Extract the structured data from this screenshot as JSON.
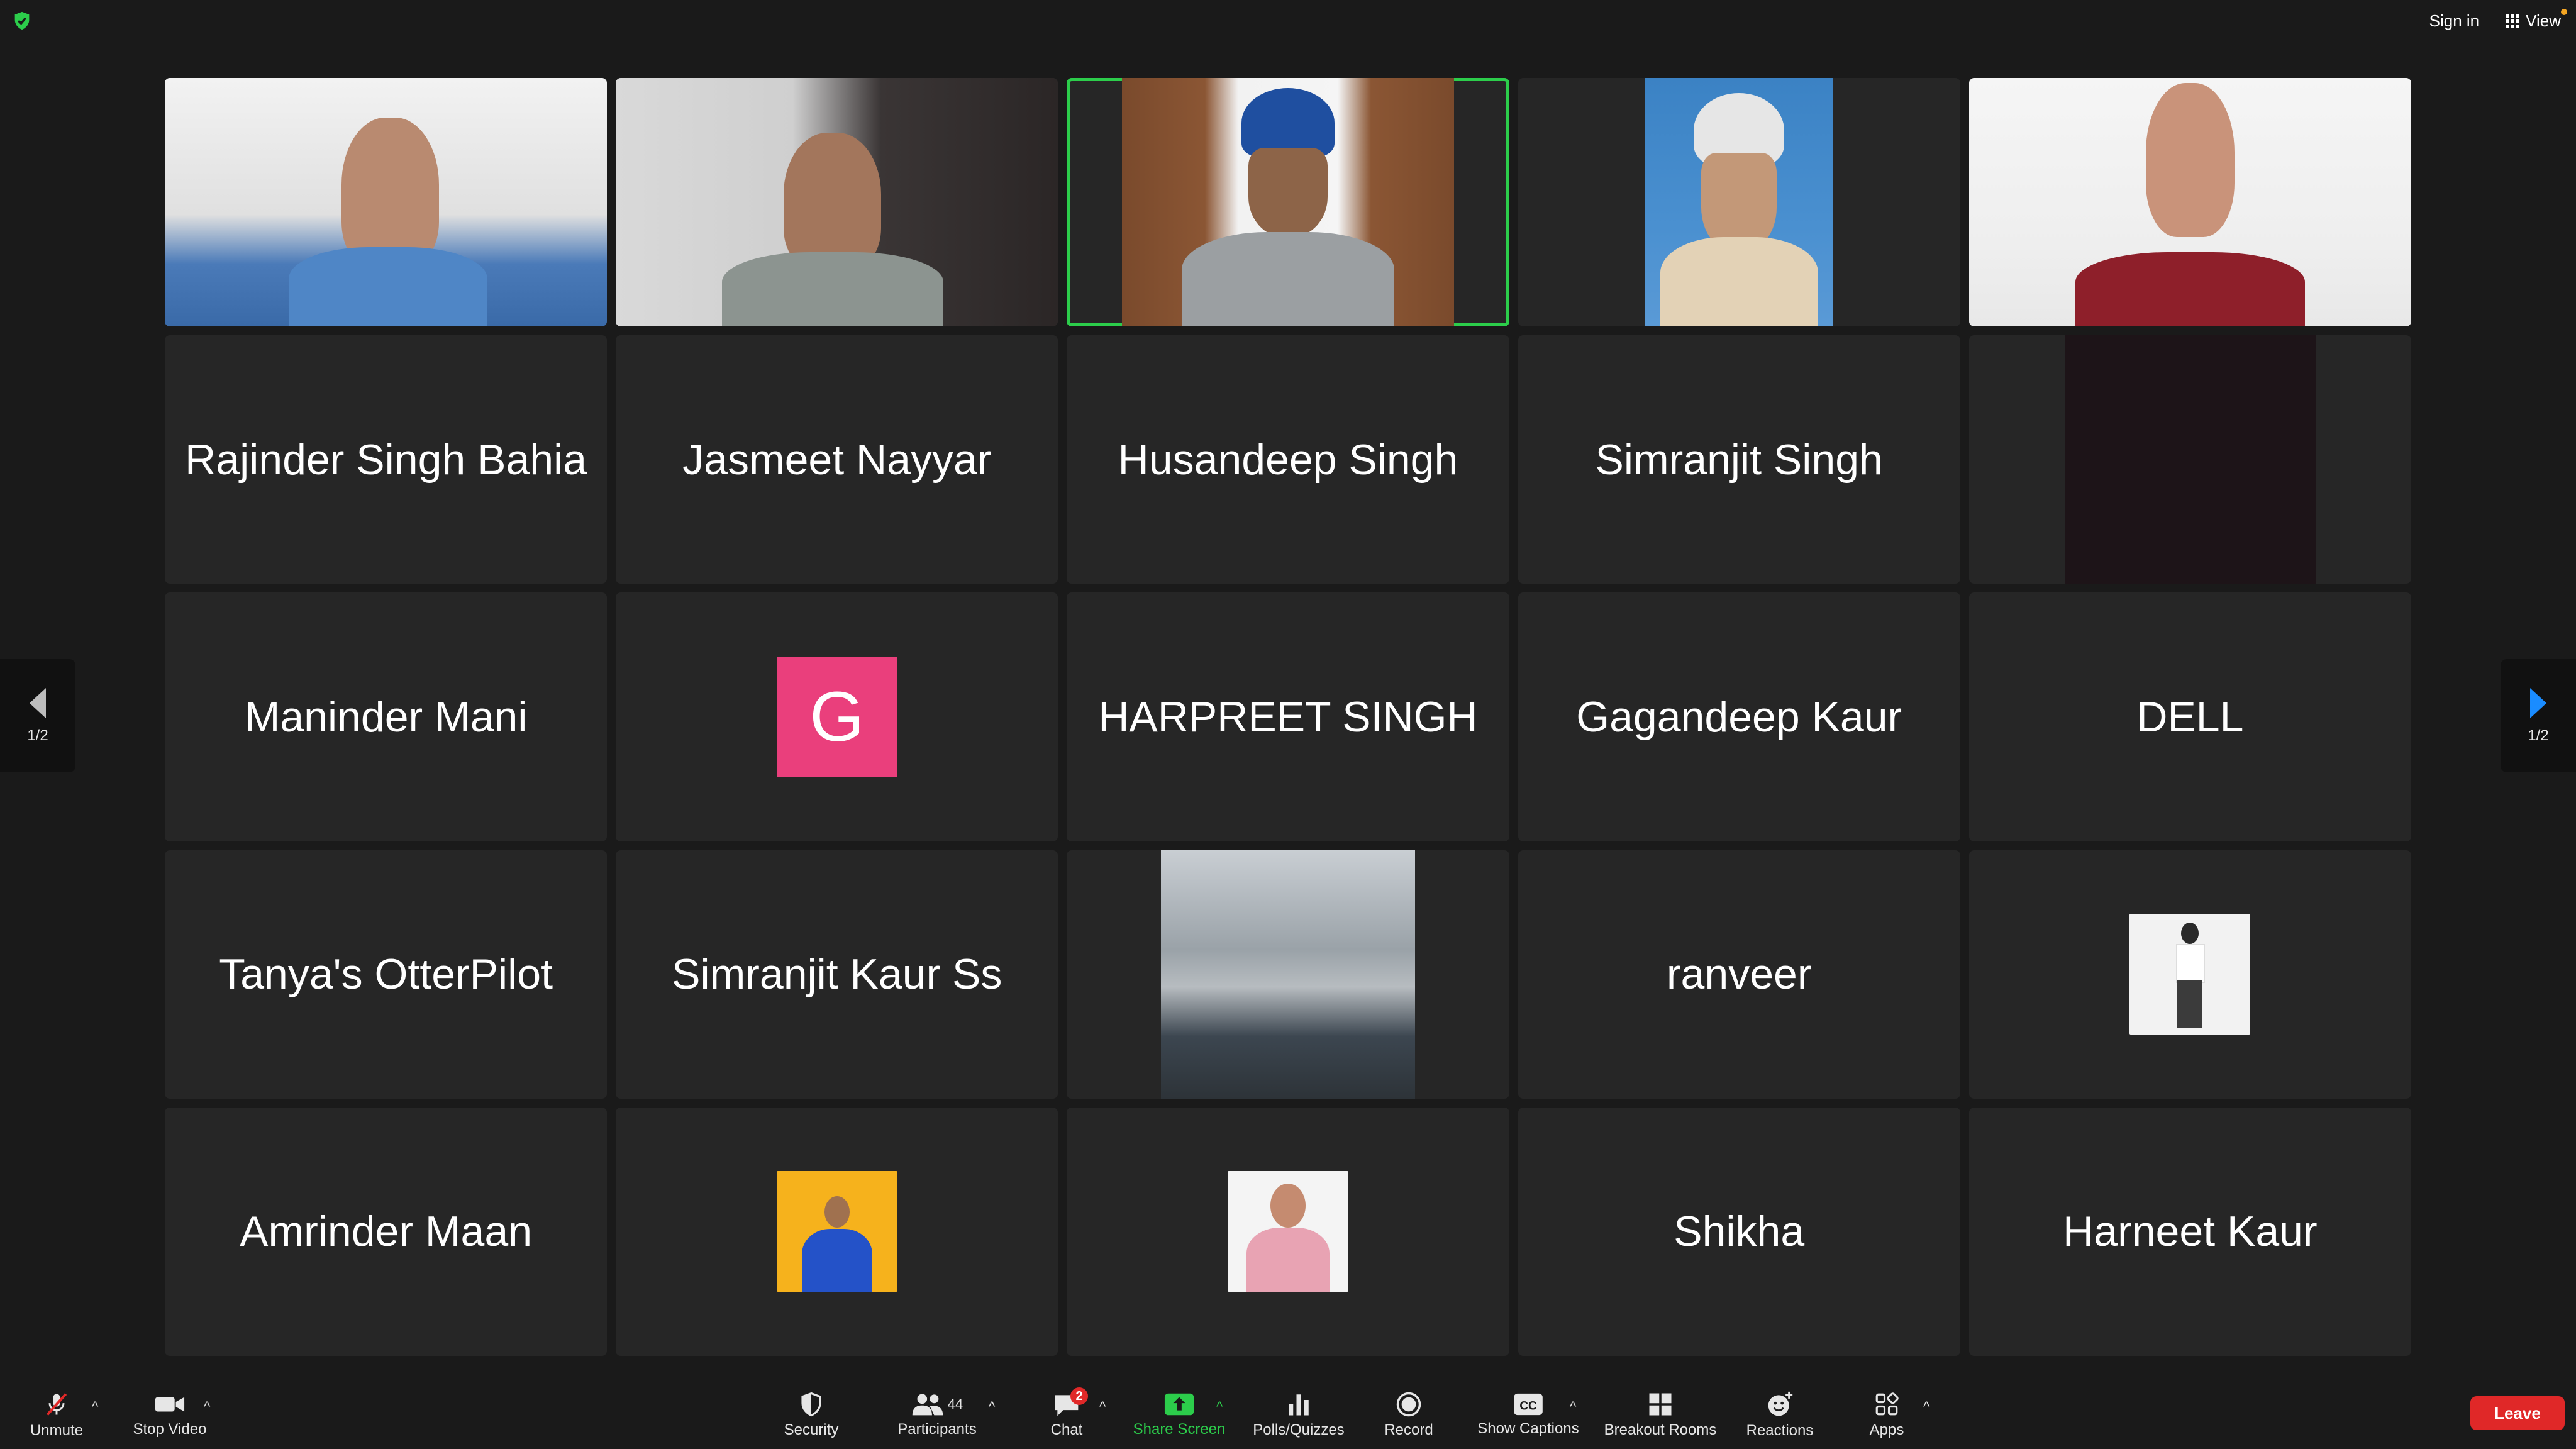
{
  "top": {
    "sign_in": "Sign in",
    "view": "View"
  },
  "pager": {
    "left_page": "1/2",
    "right_page": "1/2"
  },
  "tiles": [
    "Rajinder Singh Bahia",
    "Jasmeet Nayyar",
    "Husandeep Singh",
    "Simranjit Singh",
    "Maninder Mani",
    "G",
    "HARPREET SINGH",
    "Gagandeep Kaur",
    "DELL",
    "Tanya's OtterPilot",
    "Simranjit Kaur Ss",
    "ranveer",
    "Amrinder Maan",
    "Shikha",
    "Harneet Kaur"
  ],
  "toolbar": {
    "unmute": "Unmute",
    "stop_video": "Stop Video",
    "security": "Security",
    "participants": "Participants",
    "participants_count": "44",
    "chat": "Chat",
    "chat_badge": "2",
    "share_screen": "Share Screen",
    "polls": "Polls/Quizzes",
    "record": "Record",
    "captions": "Show Captions",
    "breakout": "Breakout Rooms",
    "reactions": "Reactions",
    "apps": "Apps",
    "leave": "Leave"
  },
  "colors": {
    "active_speaker": "#2ccd4b",
    "share_screen": "#2ccd4b",
    "leave": "#e02828",
    "avatar_g": "#ea3f7c"
  }
}
